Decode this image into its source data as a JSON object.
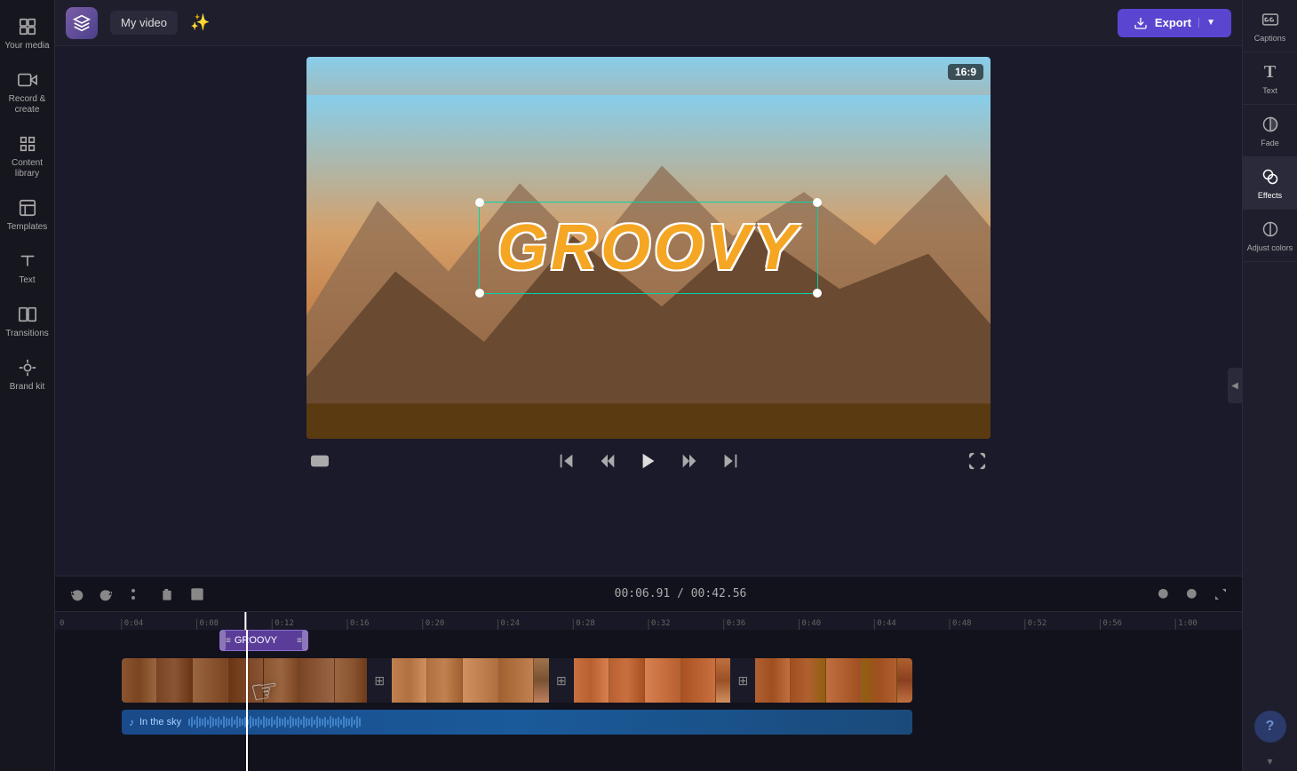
{
  "app": {
    "title": "My video",
    "logo_label": "Clipchamp"
  },
  "top_bar": {
    "video_title": "My video",
    "export_label": "Export",
    "magic_icon": "✨"
  },
  "left_sidebar": {
    "items": [
      {
        "id": "your-media",
        "label": "Your media",
        "icon": "media"
      },
      {
        "id": "record-create",
        "label": "Record & create",
        "icon": "camera"
      },
      {
        "id": "content-library",
        "label": "Content library",
        "icon": "grid"
      },
      {
        "id": "templates",
        "label": "Templates",
        "icon": "template"
      },
      {
        "id": "text",
        "label": "Text",
        "icon": "text"
      },
      {
        "id": "transitions",
        "label": "Transitions",
        "icon": "transition"
      },
      {
        "id": "brand-kit",
        "label": "Brand kit",
        "icon": "brand"
      }
    ]
  },
  "right_panel": {
    "items": [
      {
        "id": "captions",
        "label": "Captions",
        "icon": "cc"
      },
      {
        "id": "text",
        "label": "Text",
        "icon": "T"
      },
      {
        "id": "fade",
        "label": "Fade",
        "icon": "fade"
      },
      {
        "id": "effects",
        "label": "Effects",
        "icon": "effects"
      },
      {
        "id": "adjust-colors",
        "label": "Adjust colors",
        "icon": "adjust"
      }
    ]
  },
  "video": {
    "aspect_ratio": "16:9",
    "text_overlay": "GROOVY"
  },
  "playback": {
    "current_time": "00:06.91",
    "total_time": "00:42.56"
  },
  "timeline": {
    "ruler_marks": [
      "0",
      "0:04",
      "0:08",
      "0:12",
      "0:16",
      "0:20",
      "0:24",
      "0:28",
      "0:32",
      "0:36",
      "0:40",
      "0:44",
      "0:48",
      "0:52",
      "0:56",
      "1:00"
    ],
    "text_clip_label": "GROOVY",
    "audio_label": "In the sky"
  },
  "toolbar": {
    "undo_label": "Undo",
    "redo_label": "Redo",
    "cut_label": "Cut",
    "delete_label": "Delete",
    "save_label": "Save"
  }
}
